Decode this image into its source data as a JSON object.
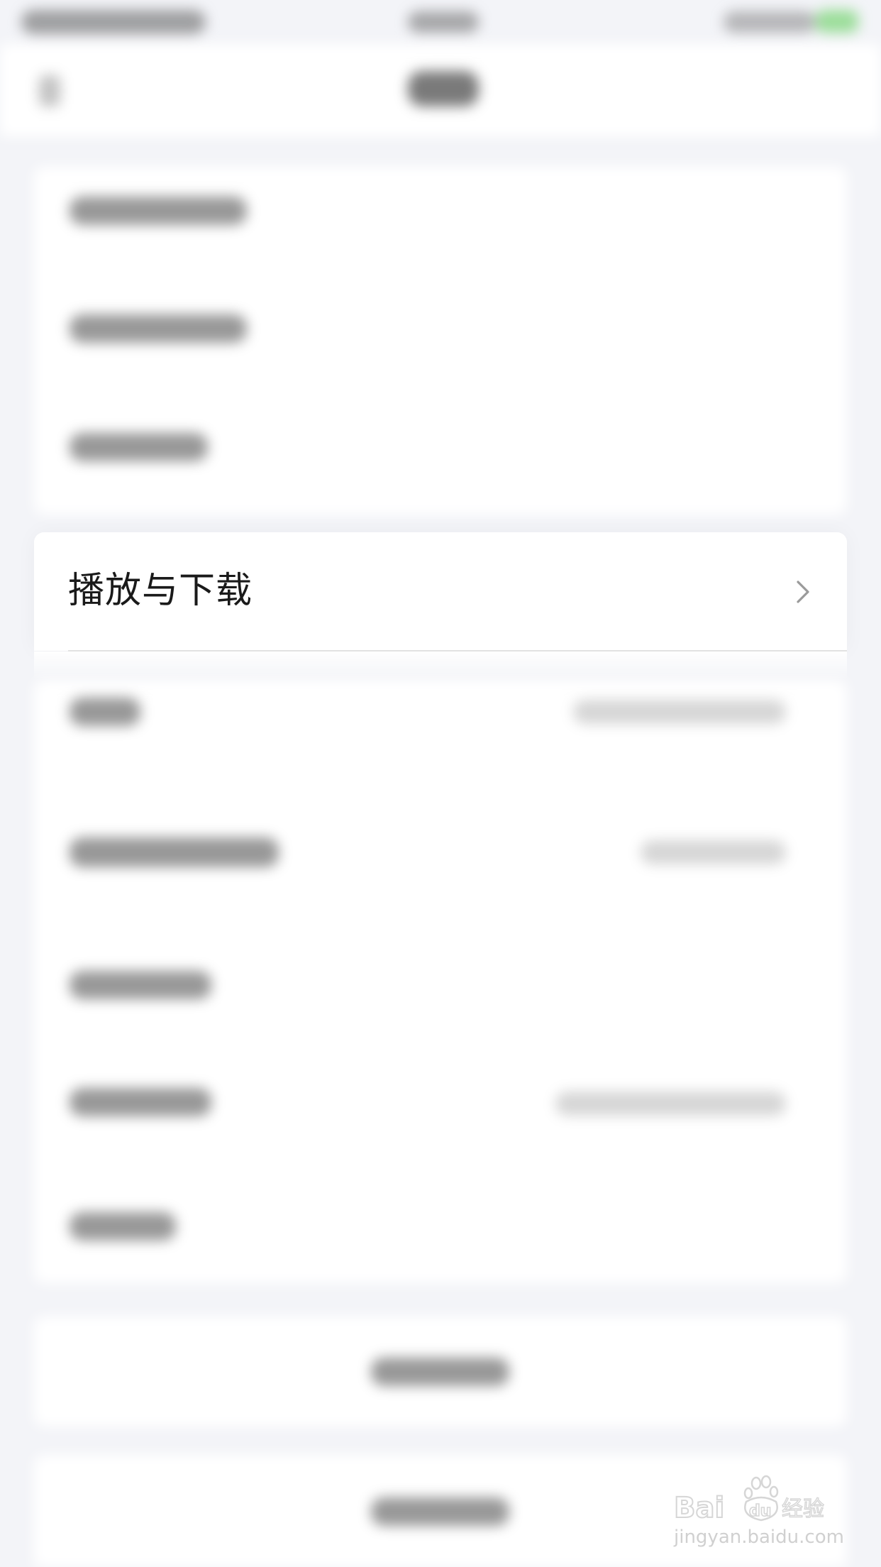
{
  "focused_row": {
    "label": "播放与下载",
    "icon": "chevron-right-icon"
  },
  "watermark": {
    "brand": "Baidu经验",
    "url": "jingyan.baidu.com"
  },
  "colors": {
    "background": "#f3f4f8",
    "card": "#ffffff",
    "label_text": "#1a1a1a",
    "chevron": "#9a9a9a",
    "divider": "#e2e2e2",
    "battery": "#7ed67a",
    "watermark": "#d6d6d6"
  }
}
